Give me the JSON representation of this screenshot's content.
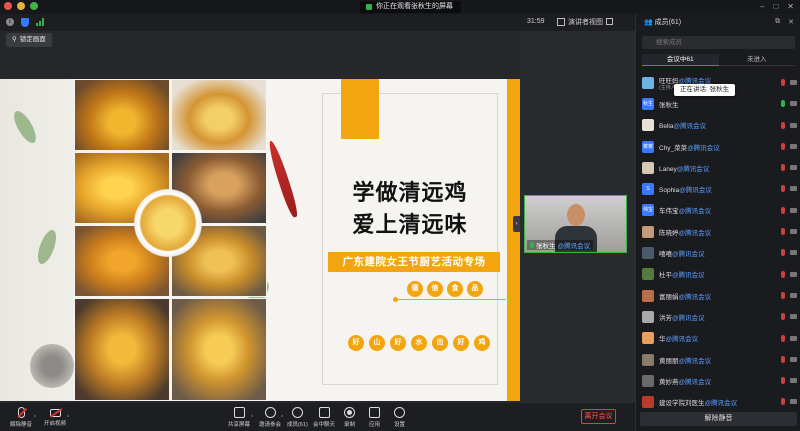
{
  "titlebar": {
    "viewing_text": "你正在观看张秋生的屏幕"
  },
  "toolbar": {
    "timer": "31:59",
    "speaker_view": "演讲者视图",
    "lock_screen": "锁定画面"
  },
  "slide": {
    "title_line1": "学做清远鸡",
    "title_line2": "爱上清远味",
    "banner": "广东建院女王节厨艺活动专场",
    "badges_top": [
      "德",
      "信",
      "食",
      "品"
    ],
    "badges_bottom": [
      "好",
      "山",
      "好",
      "水",
      "出",
      "好",
      "鸡"
    ]
  },
  "video": {
    "name": "张秋生",
    "org": "@腾讯会议"
  },
  "panel": {
    "title": "成员(61)",
    "search_placeholder": "搜索成员",
    "tabs": [
      "会议中61",
      "未进入"
    ],
    "speaking_tooltip": "正在讲话: 张秋生",
    "participants": [
      {
        "name": "旺旺妈",
        "org": "@腾讯会议",
        "sub": "(主持人,我)",
        "avatar_text": "",
        "color": "#6cb3e8"
      },
      {
        "name": "张秋生",
        "org": "",
        "sub": "",
        "avatar_text": "秋生",
        "color": "#3a78ff"
      },
      {
        "name": "Bella",
        "org": "@腾讯会议",
        "sub": "",
        "avatar_text": "",
        "color": "#e9e2d4"
      },
      {
        "name": "Chy_菜菜",
        "org": "@腾讯会议",
        "sub": "",
        "avatar_text": "菜菜",
        "color": "#3a78ff"
      },
      {
        "name": "Laney",
        "org": "@腾讯会议",
        "sub": "",
        "avatar_text": "",
        "color": "#d6c8b4"
      },
      {
        "name": "Sophia",
        "org": "@腾讯会议",
        "sub": "",
        "avatar_text": "S",
        "color": "#3a78ff"
      },
      {
        "name": "车伟宝",
        "org": "@腾讯会议",
        "sub": "",
        "avatar_text": "伟宝",
        "color": "#3a78ff"
      },
      {
        "name": "陈晓婷",
        "org": "@腾讯会议",
        "sub": "",
        "avatar_text": "",
        "color": "#c69b7a"
      },
      {
        "name": "嘻嘻",
        "org": "@腾讯会议",
        "sub": "",
        "avatar_text": "",
        "color": "#4b5a6b"
      },
      {
        "name": "杜平",
        "org": "@腾讯会议",
        "sub": "",
        "avatar_text": "",
        "color": "#557a3f"
      },
      {
        "name": "富丽娟",
        "org": "@腾讯会议",
        "sub": "",
        "avatar_text": "",
        "color": "#b86f4a"
      },
      {
        "name": "洪芳",
        "org": "@腾讯会议",
        "sub": "",
        "avatar_text": "",
        "color": "#a9a9a9"
      },
      {
        "name": "华",
        "org": "@腾讯会议",
        "sub": "",
        "avatar_text": "",
        "color": "#e8a060"
      },
      {
        "name": "黄丽丽",
        "org": "@腾讯会议",
        "sub": "",
        "avatar_text": "",
        "color": "#8a7a6a"
      },
      {
        "name": "黄妙燕",
        "org": "@腾讯会议",
        "sub": "",
        "avatar_text": "",
        "color": "#6a6a6a"
      },
      {
        "name": "建设学院刘医生",
        "org": "@腾讯会议",
        "sub": "",
        "avatar_text": "",
        "color": "#b83a2a"
      }
    ],
    "unmute_all": "解除静音"
  },
  "bottombar": {
    "unmute": "解除静音",
    "start_video": "开启视频",
    "share_screen": "共享屏幕",
    "invite": "邀请参会",
    "members": "成员(61)",
    "chat": "会中聊天",
    "record": "录制",
    "apps": "应用",
    "settings": "设置",
    "leave": "离开会议"
  }
}
